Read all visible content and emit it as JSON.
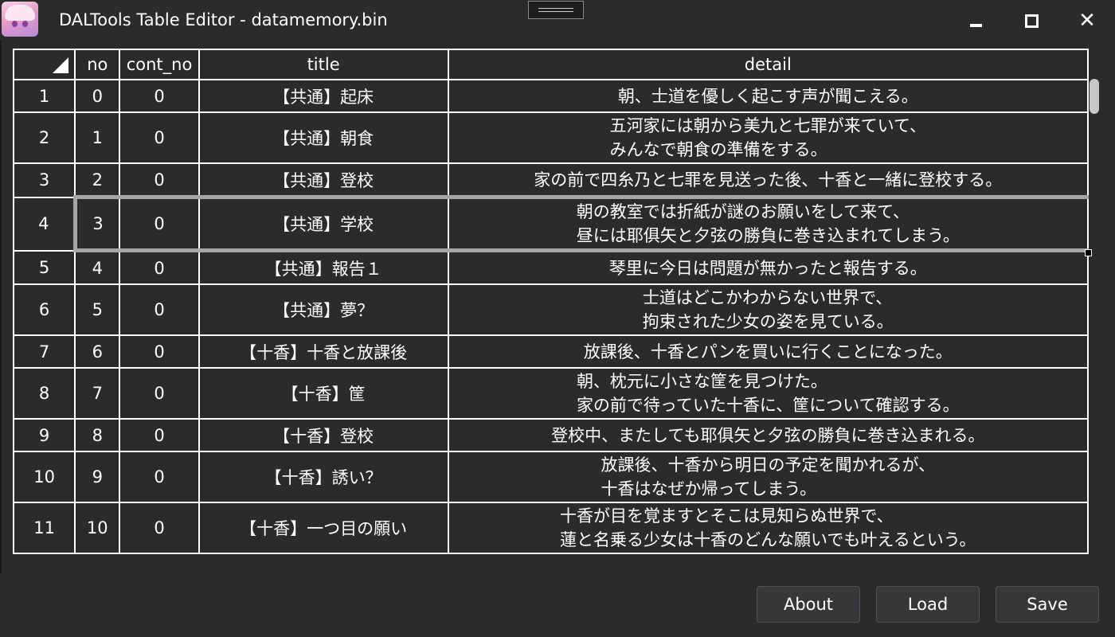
{
  "window": {
    "title": "DALTools Table Editor - datamemory.bin",
    "close_glyph": "✕"
  },
  "grid": {
    "columns": [
      "no",
      "cont_no",
      "title",
      "detail"
    ],
    "rows": [
      {
        "index": "1",
        "no": "0",
        "cont_no": "0",
        "title": "【共通】起床",
        "detail": "朝、士道を優しく起こす声が聞こえる。"
      },
      {
        "index": "2",
        "no": "1",
        "cont_no": "0",
        "title": "【共通】朝食",
        "detail": "五河家には朝から美九と七罪が来ていて、\nみんなで朝食の準備をする。"
      },
      {
        "index": "3",
        "no": "2",
        "cont_no": "0",
        "title": "【共通】登校",
        "detail": "家の前で四糸乃と七罪を見送った後、十香と一緒に登校する。"
      },
      {
        "index": "4",
        "no": "3",
        "cont_no": "0",
        "title": "【共通】学校",
        "detail": "朝の教室では折紙が謎のお願いをして来て、\n昼には耶俱矢と夕弦の勝負に巻き込まれてしまう。"
      },
      {
        "index": "5",
        "no": "4",
        "cont_no": "0",
        "title": "【共通】報告１",
        "detail": "琴里に今日は問題が無かったと報告する。"
      },
      {
        "index": "6",
        "no": "5",
        "cont_no": "0",
        "title": "【共通】夢？",
        "detail": "士道はどこかわからない世界で、\n拘束された少女の姿を見ている。"
      },
      {
        "index": "7",
        "no": "6",
        "cont_no": "0",
        "title": "【十香】十香と放課後",
        "detail": "放課後、十香とパンを買いに行くことになった。"
      },
      {
        "index": "8",
        "no": "7",
        "cont_no": "0",
        "title": "【十香】筐",
        "detail": "朝、枕元に小さな筐を見つけた。\n家の前で待っていた十香に、筐について確認する。"
      },
      {
        "index": "9",
        "no": "8",
        "cont_no": "0",
        "title": "【十香】登校",
        "detail": "登校中、またしても耶俱矢と夕弦の勝負に巻き込まれる。"
      },
      {
        "index": "10",
        "no": "9",
        "cont_no": "0",
        "title": "【十香】誘い？",
        "detail": "放課後、十香から明日の予定を聞かれるが、\n十香はなぜか帰ってしまう。"
      },
      {
        "index": "11",
        "no": "10",
        "cont_no": "0",
        "title": "【十香】一つ目の願い",
        "detail": "十香が目を覚ますとそこは見知らぬ世界で、\n蓮と名乗る少女は十香のどんな願いでも叶えるという。"
      }
    ],
    "selected_row_index": "4"
  },
  "buttons": {
    "about": "About",
    "load": "Load",
    "save": "Save"
  }
}
